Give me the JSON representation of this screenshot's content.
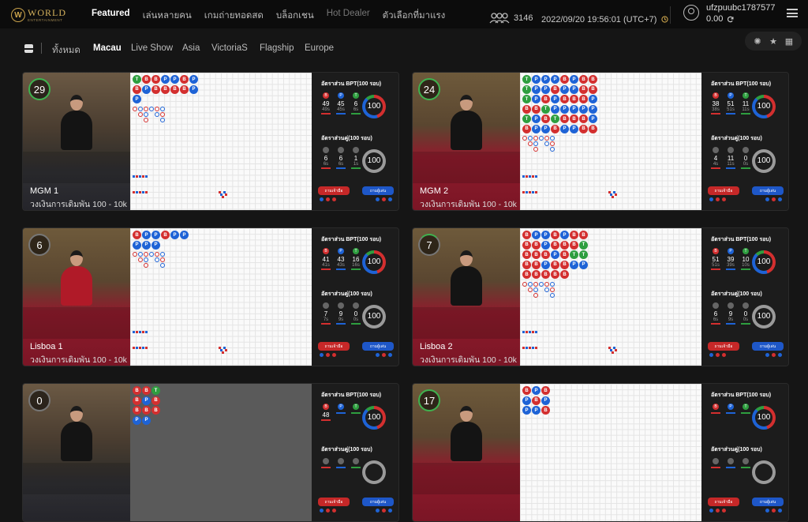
{
  "header": {
    "nav": [
      {
        "label": "Featured",
        "state": "active"
      },
      {
        "label": "เล่นหลายคน",
        "state": "normal"
      },
      {
        "label": "เกมถ่ายทอดสด",
        "state": "normal"
      },
      {
        "label": "บล็อกเชน",
        "state": "normal"
      },
      {
        "label": "Hot Dealer",
        "state": "dim"
      },
      {
        "label": "ตัวเลือกที่มาแรง",
        "state": "normal"
      }
    ],
    "players": "3146",
    "datetime": "2022/09/20 19:56:01 (UTC+7)",
    "username": "ufzpuubc1787577",
    "balance": "0.00"
  },
  "tabs": [
    "ทั้งหมด",
    "Macau",
    "Live Show",
    "Asia",
    "VictoriaS",
    "Flagship",
    "Europe"
  ],
  "active_tab": "Macau",
  "stat_labels": {
    "bpt": "อัตราส่วน BPT(100 รอบ)",
    "pair": "อัตราส่วนคู่(100 รอบ)",
    "banker_btn": "ถามเจ้ามือ",
    "player_btn": "ถามผู้เล่น"
  },
  "cards": [
    {
      "name": "MGM 1",
      "limit": "วงเงินการเดิมพัน 100 - 10k",
      "count": "29",
      "theme": "dark",
      "bpt": {
        "b": "49",
        "p": "45",
        "t": "6",
        "bs": "49s",
        "ps": "45s",
        "ts": "6s",
        "total": "100"
      },
      "pair": {
        "a": "6",
        "b": "6",
        "c": "1",
        "as": "6s",
        "bs": "6s",
        "cs": "1s",
        "total": "100"
      }
    },
    {
      "name": "MGM 2",
      "limit": "วงเงินการเดิมพัน 100 - 10k",
      "count": "24",
      "theme": "red",
      "bpt": {
        "b": "38",
        "p": "51",
        "t": "11",
        "bs": "38s",
        "ps": "51s",
        "ts": "11s",
        "total": "100"
      },
      "pair": {
        "a": "4",
        "b": "11",
        "c": "0",
        "as": "4s",
        "bs": "11s",
        "cs": "0s",
        "total": "100"
      }
    },
    {
      "name": "Lisboa 1",
      "limit": "วงเงินการเดิมพัน 100 - 10k",
      "count": "6",
      "theme": "red",
      "bpt": {
        "b": "41",
        "p": "43",
        "t": "16",
        "bs": "41s",
        "ps": "43s",
        "ts": "16s",
        "total": "100"
      },
      "pair": {
        "a": "7",
        "b": "9",
        "c": "0",
        "as": "7s",
        "bs": "9s",
        "cs": "0s",
        "total": "100"
      }
    },
    {
      "name": "Lisboa 2",
      "limit": "วงเงินการเดิมพัน 100 - 10k",
      "count": "7",
      "theme": "red",
      "bpt": {
        "b": "51",
        "p": "39",
        "t": "10",
        "bs": "51s",
        "ps": "39s",
        "ts": "10s",
        "total": "100"
      },
      "pair": {
        "a": "6",
        "b": "9",
        "c": "0",
        "as": "6s",
        "bs": "9s",
        "cs": "0s",
        "total": "100"
      }
    },
    {
      "name": "",
      "limit": "",
      "count": "0",
      "theme": "dark",
      "bpt": {
        "b": "48",
        "p": "",
        "t": "",
        "bs": "",
        "ps": "",
        "ts": "",
        "total": "100"
      },
      "pair": {
        "a": "",
        "b": "",
        "c": "",
        "as": "",
        "bs": "",
        "cs": "",
        "total": ""
      }
    },
    {
      "name": "",
      "limit": "",
      "count": "17",
      "theme": "red",
      "bpt": {
        "b": "",
        "p": "",
        "t": "",
        "bs": "",
        "ps": "",
        "ts": "",
        "total": "100"
      },
      "pair": {
        "a": "",
        "b": "",
        "c": "",
        "as": "",
        "bs": "",
        "cs": "",
        "total": ""
      }
    }
  ],
  "colors": {
    "banker": "#d32f2f",
    "player": "#1e63d6",
    "tie": "#2e9e3f",
    "accent_green": "#3fb24f"
  }
}
